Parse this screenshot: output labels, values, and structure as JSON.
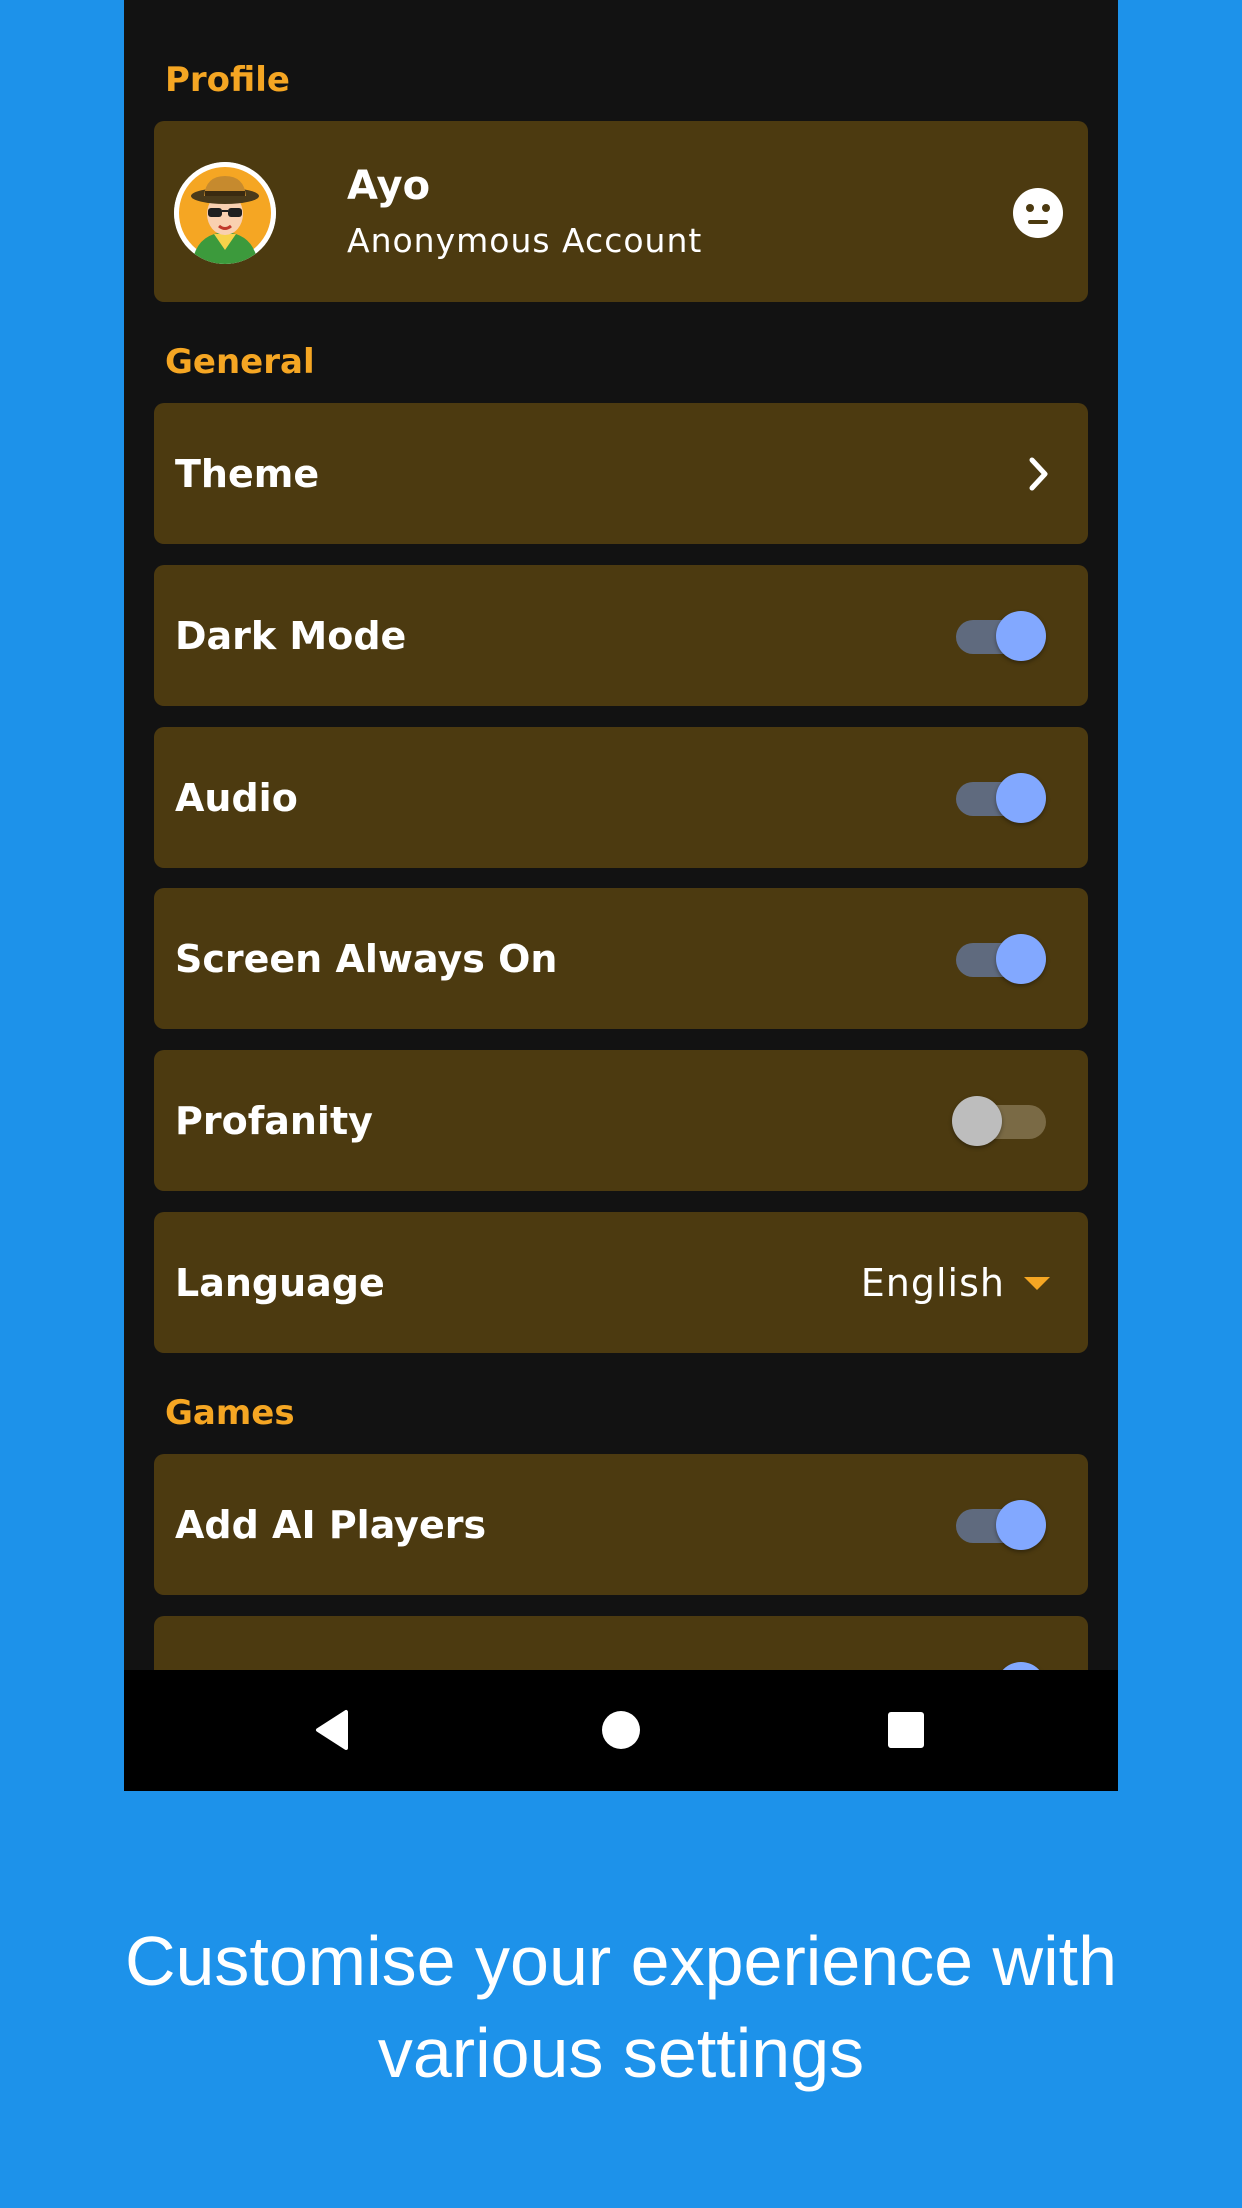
{
  "sections": {
    "profile": "Profile",
    "general": "General",
    "games": "Games"
  },
  "profile": {
    "name": "Ayo",
    "account_type": "Anonymous Account",
    "avatar_icon": "avatar-cowboy-sunglasses",
    "status_icon": "neutral-face-icon"
  },
  "general": {
    "theme": {
      "label": "Theme",
      "icon": "chevron-right-icon"
    },
    "dark_mode": {
      "label": "Dark Mode",
      "enabled": true
    },
    "audio": {
      "label": "Audio",
      "enabled": true
    },
    "screen_always_on": {
      "label": "Screen Always On",
      "enabled": true
    },
    "profanity": {
      "label": "Profanity",
      "enabled": false
    },
    "language": {
      "label": "Language",
      "value": "English",
      "icon": "dropdown-arrow-icon"
    }
  },
  "games": {
    "add_ai_players": {
      "label": "Add AI Players",
      "enabled": true
    }
  },
  "navbar": {
    "back_icon": "back-triangle-icon",
    "home_icon": "home-circle-icon",
    "recents_icon": "recents-square-icon"
  },
  "caption": {
    "line1": "Customise your experience with",
    "line2": "various settings"
  },
  "colors": {
    "background": "#1d92ea",
    "app_background": "#121212",
    "card": "#4c3a10",
    "accent": "#f5a623",
    "toggle_on": "#82a8ff"
  }
}
